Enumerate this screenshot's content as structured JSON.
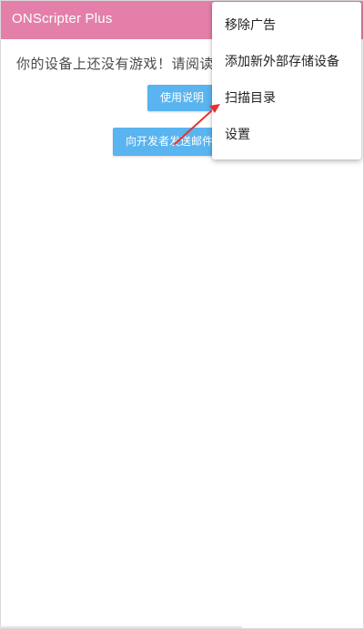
{
  "app_bar": {
    "title": "ONScripter Plus",
    "color": "#e47fa9"
  },
  "main": {
    "message": "你的设备上还没有游戏！请阅读使用说明",
    "guide_button_label": "使用说明",
    "email_button_label": "向开发者发送邮件"
  },
  "overflow_menu": {
    "items": [
      {
        "label": "移除广告"
      },
      {
        "label": "添加新外部存储设备"
      },
      {
        "label": "扫描目录"
      },
      {
        "label": "设置"
      }
    ]
  },
  "annotation": {
    "arrow_color": "#e8322e",
    "icon": "red-arrow"
  },
  "colors": {
    "button": "#59b4f0",
    "menu_background": "#ffffff"
  }
}
